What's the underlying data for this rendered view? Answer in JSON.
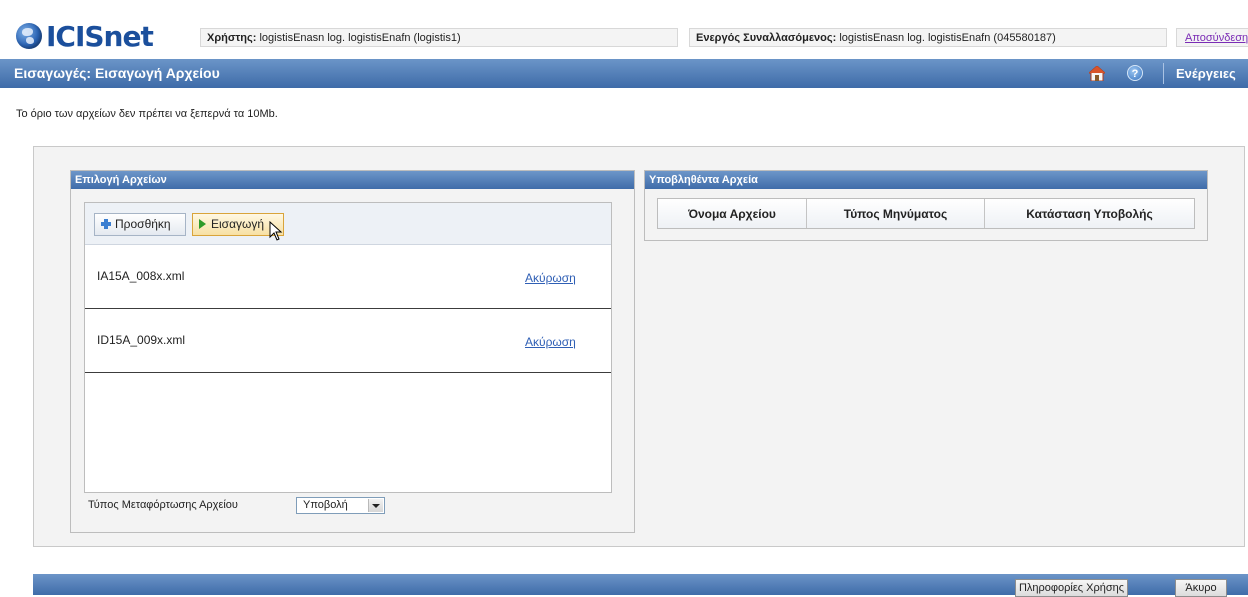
{
  "header": {
    "logo_text": "ICISnet",
    "user_label": "Χρήστης:",
    "user_value": "logistisEnasn log. logistisEnafn (logistis1)",
    "trader_label": "Ενεργός Συναλλασόμενος:",
    "trader_value": "logistisEnasn log. logistisEnafn (045580187)",
    "logout_label": "Αποσύνδεση"
  },
  "titlebar": {
    "title": "Εισαγωγές: Εισαγωγή Αρχείου",
    "help_glyph": "?",
    "actions_label": "Ενέργειες"
  },
  "size_note": "Το όριο των αρχείων δεν πρέπει να ξεπερνά τα 10Mb.",
  "left_panel": {
    "header": "Επιλογή Αρχείων",
    "add_button": "Προσθήκη",
    "import_button": "Εισαγωγή",
    "files": [
      {
        "name": "IA15A_008x.xml",
        "cancel": "Ακύρωση"
      },
      {
        "name": "ID15A_009x.xml",
        "cancel": "Ακύρωση"
      }
    ],
    "upload_type_label": "Τύπος Μεταφόρτωσης Αρχείου",
    "upload_type_value": "Υποβολή"
  },
  "right_panel": {
    "header": "Υποβληθέντα Αρχεία",
    "columns": [
      "Όνομα Αρχείου",
      "Τύπος Μηνύματος",
      "Κατάσταση Υποβολής"
    ]
  },
  "footer": {
    "info_button": "Πληροφορίες Χρήσης",
    "cancel_button": "Άκυρο"
  },
  "colors": {
    "brand_blue": "#1b4f9c",
    "titlebar_blue": "#3e6ba8",
    "link_blue": "#2f5fb5",
    "logout_purple": "#7a2cb5",
    "import_highlight": "#f7e0a3"
  },
  "icons": {
    "logo": "globe-icon",
    "home": "home-icon",
    "help": "help-icon",
    "add": "plus-icon",
    "import": "play-arrow-icon",
    "cursor": "mouse-cursor-icon"
  }
}
